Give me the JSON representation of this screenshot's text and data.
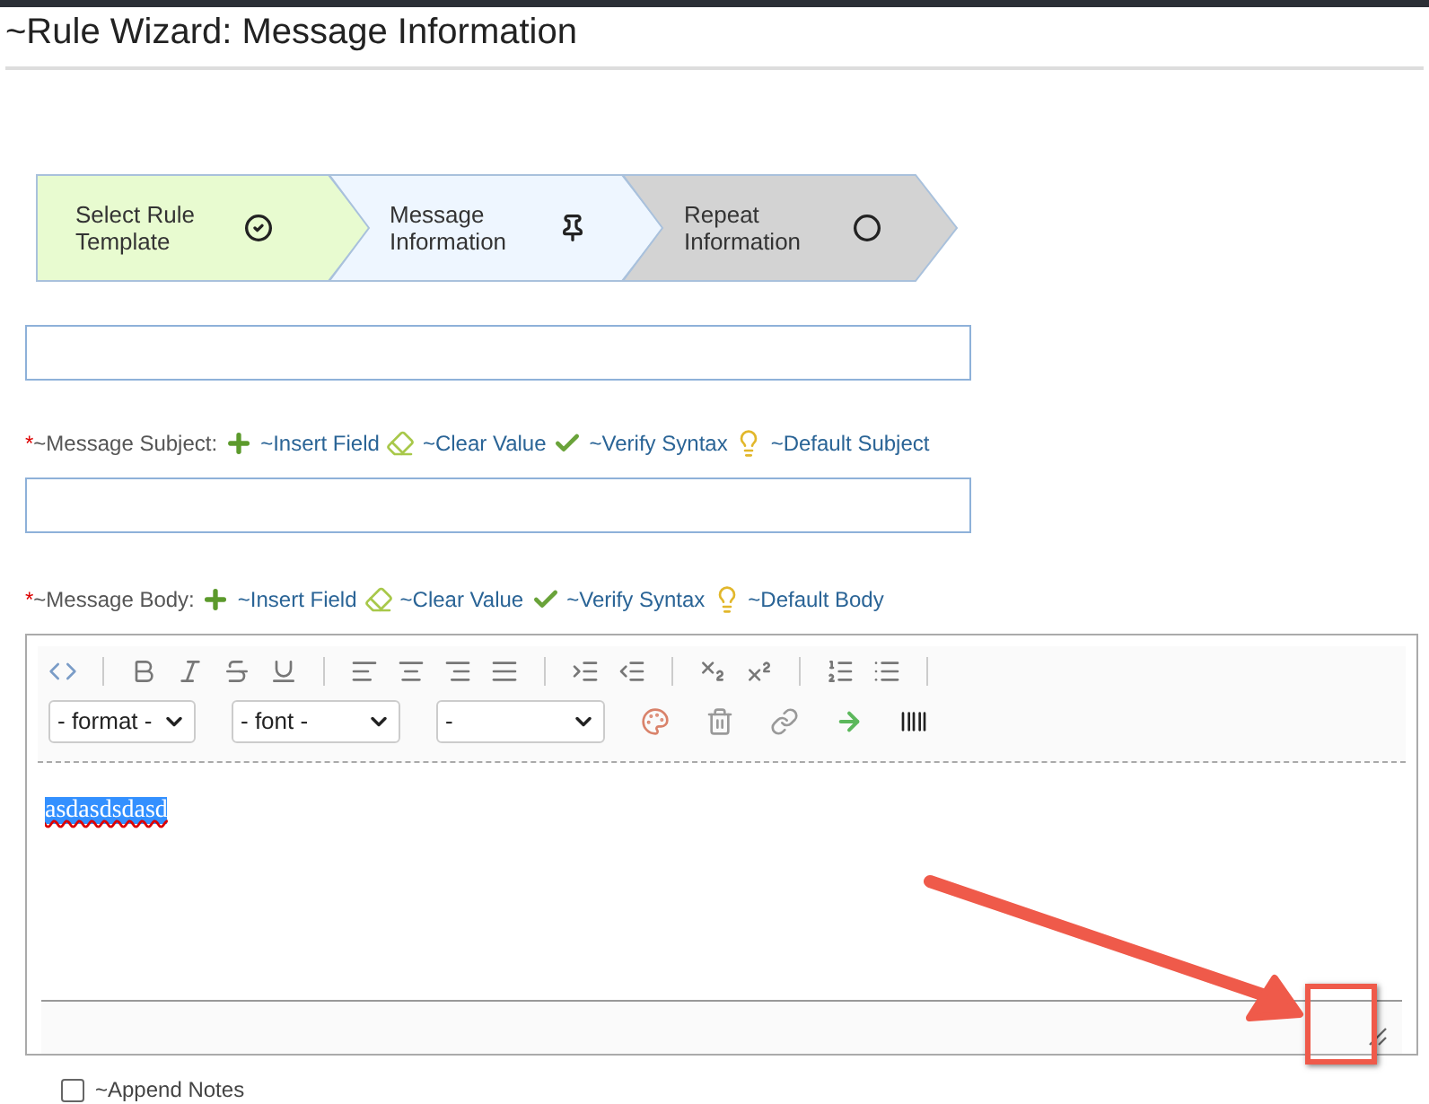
{
  "header": {
    "title": "~Rule Wizard: Message Information"
  },
  "wizard": [
    {
      "label": "Select Rule Template",
      "kind": "done"
    },
    {
      "label": "Message Information",
      "kind": "current"
    },
    {
      "label": "Repeat Information",
      "kind": "pending"
    }
  ],
  "subject": {
    "required_mark": "*",
    "label": "~Message Subject:",
    "links": [
      {
        "kind": "insert",
        "label": "~Insert Field"
      },
      {
        "kind": "clear",
        "label": "~Clear Value"
      },
      {
        "kind": "verify",
        "label": "~Verify Syntax"
      },
      {
        "kind": "default",
        "label": "~Default Subject"
      }
    ]
  },
  "body": {
    "required_mark": "*",
    "label": "~Message Body:",
    "links": [
      {
        "kind": "insert",
        "label": "~Insert Field"
      },
      {
        "kind": "clear",
        "label": "~Clear Value"
      },
      {
        "kind": "verify",
        "label": "~Verify Syntax"
      },
      {
        "kind": "default",
        "label": "~Default Body"
      }
    ],
    "selects": [
      {
        "value": "- format -"
      },
      {
        "value": "- font -"
      },
      {
        "value": "-"
      }
    ],
    "content": "asdasdsdasd",
    "content_selected": true
  },
  "append_notes": {
    "label": "~Append Notes",
    "checked": false
  }
}
